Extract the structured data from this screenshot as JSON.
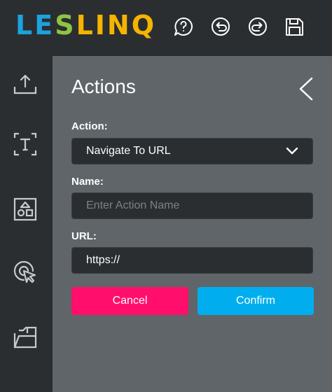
{
  "header": {
    "logo_text": "LESLINQ",
    "logo_letters": [
      "L",
      "E",
      "S",
      "L",
      "I",
      "N",
      "Q"
    ],
    "icons": [
      "help-icon",
      "undo-icon",
      "redo-icon",
      "save-icon"
    ]
  },
  "sidebar": {
    "items": [
      {
        "icon": "upload-icon"
      },
      {
        "icon": "text-icon"
      },
      {
        "icon": "shapes-icon"
      },
      {
        "icon": "cursor-click-icon"
      },
      {
        "icon": "folder-icon"
      }
    ]
  },
  "panel": {
    "title": "Actions",
    "action_label": "Action:",
    "action_value": "Navigate To URL",
    "name_label": "Name:",
    "name_placeholder": "Enter Action Name",
    "name_value": "",
    "url_label": "URL:",
    "url_value": "https://",
    "cancel_label": "Cancel",
    "confirm_label": "Confirm"
  },
  "colors": {
    "bar_bg": "#2b2e31",
    "panel_bg": "#5f6568",
    "cancel": "#ff0f6b",
    "confirm": "#00aeef",
    "logo_blue": "#1ba3df",
    "logo_green": "#8ec444",
    "logo_yellow": "#f5b400"
  }
}
